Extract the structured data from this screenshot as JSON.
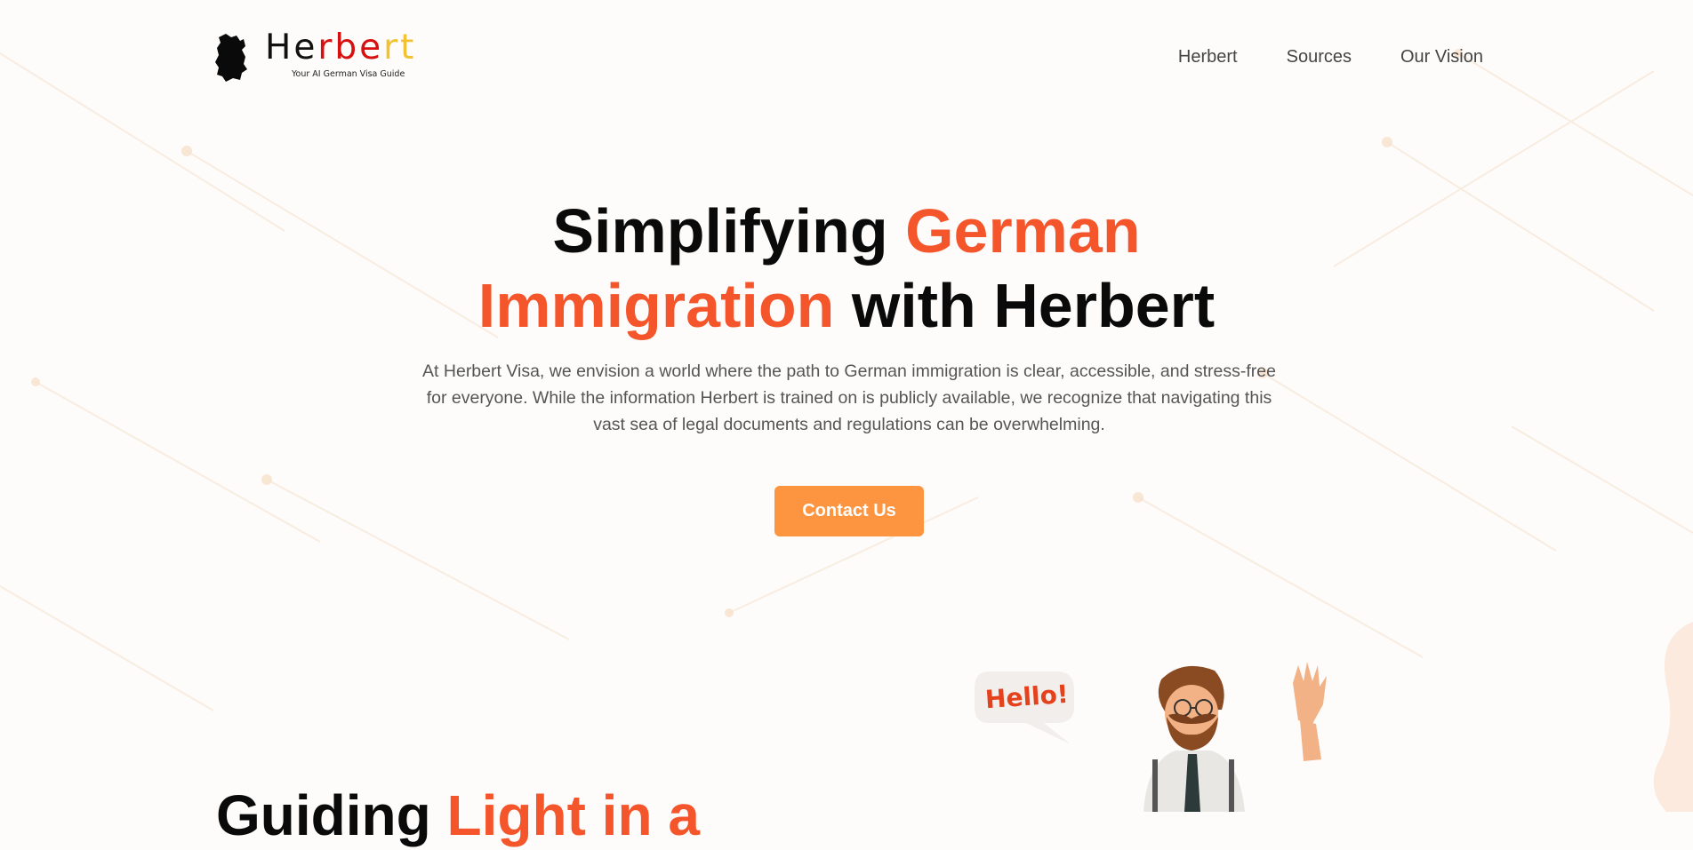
{
  "header": {
    "brand": {
      "part1": "He",
      "part2": "rbe",
      "part3": "rt"
    },
    "tagline": "Your AI German Visa Guide",
    "nav": [
      "Herbert",
      "Sources",
      "Our Vision"
    ]
  },
  "hero": {
    "title_plain_1": "Simplifying ",
    "title_accent_1": "German",
    "title_accent_2": "Immigration",
    "title_plain_2": " with Herbert",
    "description": "At Herbert Visa, we envision a world where the path to German immigration is clear, accessible, and stress-free for everyone. While the information Herbert is trained on is publicly available, we recognize that navigating this vast sea of legal documents and regulations can be overwhelming.",
    "cta_label": "Contact Us"
  },
  "section": {
    "title_plain": "Guiding ",
    "title_accent": "Light in a"
  },
  "mascot": {
    "speech": "Hello!"
  },
  "colors": {
    "accent": "#f4552a",
    "cta": "#fd9540",
    "text": "#0a0a0a",
    "muted": "#555555"
  }
}
